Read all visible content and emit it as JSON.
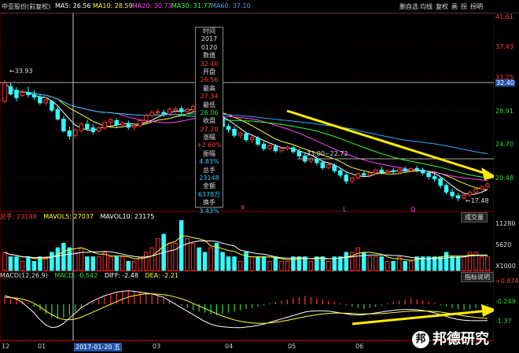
{
  "header": {
    "title": "中亚股份(前复权)",
    "ma5": "MA5: 26.56",
    "ma10": "MA10: 28.59",
    "ma20": "MA20: 30.73",
    "ma30": "MA30: 31.77",
    "ma60": "MA60: 37.10",
    "btn_self": "删自选",
    "btn_compare": "均线",
    "btn_chip": "复权",
    "btn_draw": "画",
    "btn_switch": "拐",
    "btn_last": "拐明"
  },
  "price_axis": {
    "labels": [
      "41.61",
      "37.43",
      "33.25",
      "32.40",
      "28.91",
      "24.70",
      "20.48",
      "17.48"
    ]
  },
  "annotations": {
    "high_mark": "←33.93",
    "mid_mark": "33.00~22.72",
    "low_mark": "←17.48",
    "mark_l": "L",
    "mark_q": "Q",
    "mark_r": "R"
  },
  "tooltip": {
    "rows": [
      {
        "text": "时间",
        "color": "#ddd"
      },
      {
        "text": "2017",
        "color": "#ddd"
      },
      {
        "text": "0120",
        "color": "#ddd"
      },
      {
        "text": "数值",
        "color": "#ddd"
      },
      {
        "text": "32.40",
        "color": "#ff4040"
      },
      {
        "text": "开盘",
        "color": "#ddd"
      },
      {
        "text": "26.56",
        "color": "#ff4040"
      },
      {
        "text": "最高",
        "color": "#ddd"
      },
      {
        "text": "27.34",
        "color": "#ff4040"
      },
      {
        "text": "最低",
        "color": "#ddd"
      },
      {
        "text": "26.06",
        "color": "#33dd33"
      },
      {
        "text": "收盘",
        "color": "#ddd"
      },
      {
        "text": "27.20",
        "color": "#ff4040"
      },
      {
        "text": "涨幅",
        "color": "#ddd"
      },
      {
        "text": "+2.60%",
        "color": "#ff4040"
      },
      {
        "text": "振幅",
        "color": "#ddd"
      },
      {
        "text": "4.83%",
        "color": "#33ccff"
      },
      {
        "text": "总手",
        "color": "#ddd"
      },
      {
        "text": "23148",
        "color": "#33ccff"
      },
      {
        "text": "金额",
        "color": "#ddd"
      },
      {
        "text": "6378万",
        "color": "#33ccff"
      },
      {
        "text": "换手",
        "color": "#ddd"
      },
      {
        "text": "3.43%",
        "color": "#33ccff"
      }
    ]
  },
  "volume_panel": {
    "label": "总手: 23148",
    "mavol5": "MAVOL5: 27037",
    "mavol10": "MAVOL10: 23175",
    "button": "成交量",
    "axis": [
      "11280",
      "5620",
      "X1000"
    ]
  },
  "macd_panel": {
    "label": "MACD(12,26,9)",
    "macd": "MACD: -0.542",
    "diff": "DIFF: -2.48",
    "dea": "DEA: -2.21",
    "button": "指标说明",
    "axis": [
      "+0.874",
      "-0.249",
      "-1.37"
    ]
  },
  "date_axis": {
    "labels": [
      "12",
      "01",
      "2017-01-20 五",
      "03",
      "04",
      "05",
      "06"
    ]
  },
  "watermark": {
    "logo": "邦",
    "text": "邦德研究"
  },
  "chart_data": {
    "type": "candlestick",
    "ylim": [
      16.5,
      42.5
    ],
    "candles": [
      [
        31.0,
        33.9,
        33.5,
        30.8
      ],
      [
        33.0,
        33.6,
        32.0,
        31.8
      ],
      [
        32.5,
        32.9,
        31.5,
        31.0
      ],
      [
        31.8,
        32.6,
        32.2,
        31.6
      ],
      [
        32.2,
        33.0,
        31.9,
        31.5
      ],
      [
        31.9,
        32.5,
        31.6,
        31.2
      ],
      [
        31.6,
        32.0,
        30.8,
        30.5
      ],
      [
        30.8,
        31.6,
        31.2,
        30.4
      ],
      [
        31.0,
        31.2,
        29.8,
        29.5
      ],
      [
        29.9,
        30.4,
        28.6,
        28.4
      ],
      [
        28.6,
        29.0,
        27.0,
        26.8
      ],
      [
        27.0,
        27.6,
        26.3,
        25.8
      ],
      [
        26.4,
        27.4,
        27.1,
        26.0
      ],
      [
        27.0,
        28.2,
        27.9,
        26.8
      ],
      [
        27.9,
        28.5,
        27.3,
        27.0
      ],
      [
        27.4,
        27.9,
        26.9,
        26.5
      ],
      [
        27.0,
        27.6,
        27.4,
        26.7
      ],
      [
        27.4,
        28.4,
        28.2,
        27.2
      ],
      [
        28.2,
        28.8,
        28.5,
        27.8
      ],
      [
        28.4,
        28.7,
        27.8,
        27.5
      ],
      [
        27.8,
        28.3,
        28.1,
        27.4
      ],
      [
        28.0,
        28.4,
        27.5,
        27.2
      ],
      [
        27.5,
        28.0,
        27.7,
        27.0
      ],
      [
        27.7,
        28.6,
        28.4,
        27.5
      ],
      [
        28.4,
        29.3,
        29.1,
        28.2
      ],
      [
        29.1,
        29.8,
        29.5,
        28.8
      ],
      [
        29.5,
        30.0,
        29.6,
        29.1
      ],
      [
        29.5,
        29.9,
        29.3,
        28.9
      ],
      [
        29.3,
        30.2,
        29.9,
        29.0
      ],
      [
        29.8,
        30.3,
        30.0,
        29.4
      ],
      [
        30.0,
        30.4,
        29.6,
        29.3
      ],
      [
        29.6,
        30.1,
        29.9,
        29.2
      ],
      [
        29.9,
        30.6,
        30.3,
        29.6
      ],
      [
        30.2,
        30.5,
        29.7,
        29.4
      ],
      [
        29.7,
        30.0,
        29.2,
        28.9
      ],
      [
        29.2,
        29.7,
        29.5,
        28.9
      ],
      [
        29.4,
        29.8,
        28.8,
        28.5
      ],
      [
        28.8,
        29.0,
        27.6,
        27.3
      ],
      [
        27.6,
        28.0,
        27.2,
        26.8
      ],
      [
        27.2,
        27.6,
        26.4,
        26.1
      ],
      [
        26.4,
        26.9,
        26.7,
        26.0
      ],
      [
        26.6,
        26.9,
        25.8,
        25.5
      ],
      [
        25.8,
        26.4,
        26.1,
        25.4
      ],
      [
        26.0,
        26.3,
        25.2,
        24.9
      ],
      [
        25.2,
        25.6,
        24.6,
        24.3
      ],
      [
        24.6,
        25.2,
        25.0,
        24.3
      ],
      [
        24.9,
        25.2,
        24.3,
        24.0
      ],
      [
        24.3,
        24.8,
        24.6,
        24.0
      ],
      [
        24.6,
        25.0,
        24.8,
        24.3
      ],
      [
        24.7,
        25.0,
        24.2,
        23.9
      ],
      [
        24.2,
        24.6,
        23.6,
        23.3
      ],
      [
        23.6,
        24.0,
        22.9,
        22.6
      ],
      [
        22.9,
        23.4,
        23.2,
        22.6
      ],
      [
        23.2,
        23.6,
        22.7,
        22.3
      ],
      [
        22.7,
        23.0,
        22.0,
        21.7
      ],
      [
        22.0,
        22.6,
        22.4,
        21.8
      ],
      [
        22.3,
        22.6,
        21.6,
        21.3
      ],
      [
        21.6,
        22.0,
        21.0,
        20.6
      ],
      [
        21.0,
        21.4,
        20.2,
        19.8
      ],
      [
        20.2,
        20.8,
        20.6,
        19.9
      ],
      [
        20.6,
        21.4,
        21.2,
        20.4
      ],
      [
        21.2,
        21.6,
        21.0,
        20.7
      ],
      [
        21.0,
        21.5,
        21.3,
        20.8
      ],
      [
        21.3,
        21.9,
        21.7,
        21.1
      ],
      [
        21.7,
        22.2,
        21.4,
        21.1
      ],
      [
        21.4,
        21.8,
        21.6,
        21.1
      ],
      [
        21.6,
        22.0,
        21.5,
        21.2
      ],
      [
        21.5,
        21.9,
        21.8,
        21.2
      ],
      [
        21.8,
        22.2,
        21.6,
        21.3
      ],
      [
        21.6,
        22.0,
        21.9,
        21.4
      ],
      [
        21.9,
        22.3,
        21.7,
        21.4
      ],
      [
        21.7,
        22.0,
        21.3,
        21.0
      ],
      [
        21.3,
        21.6,
        20.8,
        20.4
      ],
      [
        20.8,
        21.2,
        20.5,
        20.1
      ],
      [
        20.5,
        20.8,
        19.6,
        19.2
      ],
      [
        19.6,
        19.9,
        18.7,
        18.4
      ],
      [
        18.7,
        19.2,
        18.2,
        17.8
      ],
      [
        18.2,
        18.6,
        17.9,
        17.48
      ],
      [
        17.9,
        18.5,
        18.3,
        17.7
      ],
      [
        18.3,
        18.9,
        18.7,
        18.1
      ],
      [
        18.7,
        19.3,
        19.1,
        18.5
      ],
      [
        19.1,
        19.6,
        19.4,
        18.9
      ],
      [
        19.4,
        20.0,
        19.8,
        19.2
      ]
    ],
    "volume": [
      4,
      3,
      3,
      2,
      3,
      2,
      3,
      3,
      4,
      5,
      6,
      5,
      4,
      5,
      3,
      3,
      3,
      4,
      3,
      3,
      3,
      2,
      2,
      3,
      4,
      5,
      7,
      8,
      6,
      6,
      11,
      7,
      6,
      5,
      4,
      5,
      6,
      4,
      3,
      3,
      2,
      4,
      3,
      3,
      3,
      2,
      3,
      2,
      2,
      3,
      3,
      3,
      2,
      3,
      3,
      2,
      3,
      3,
      4,
      4,
      5,
      4,
      3,
      3,
      3,
      2,
      2,
      3,
      2,
      2,
      3,
      3,
      3,
      3,
      3,
      4,
      3,
      3,
      3,
      4,
      4,
      3,
      3
    ],
    "macd_hist": [
      0.3,
      0.25,
      0.2,
      0.15,
      0.05,
      -0.1,
      -0.25,
      -0.4,
      -0.55,
      -0.6,
      -0.55,
      -0.45,
      -0.3,
      -0.15,
      -0.05,
      0.1,
      0.2,
      0.3,
      0.4,
      0.45,
      0.55,
      0.6,
      0.55,
      0.5,
      0.45,
      0.4,
      0.35,
      0.25,
      0.15,
      0.05,
      -0.05,
      -0.15,
      -0.25,
      -0.3,
      -0.35,
      -0.4,
      -0.45,
      -0.4,
      -0.35,
      -0.3,
      -0.25,
      -0.2,
      -0.15,
      -0.1,
      -0.05,
      0.05,
      0.1,
      0.15,
      0.2,
      0.25,
      0.3,
      0.35,
      0.3,
      0.25,
      0.2,
      0.15,
      0.1,
      0.05,
      -0.05,
      -0.1,
      -0.15,
      -0.2,
      -0.15,
      -0.1,
      -0.05,
      0.05,
      0.1,
      0.15,
      0.2,
      0.25,
      0.2,
      0.15,
      0.1,
      0.05,
      -0.05,
      -0.1,
      -0.15,
      -0.2,
      -0.25,
      -0.2,
      -0.15,
      -0.1,
      -0.05
    ],
    "macd_diff": [
      0.5,
      0.4,
      0.3,
      0.1,
      -0.2,
      -0.5,
      -0.9,
      -1.2,
      -1.35,
      -1.3,
      -1.1,
      -0.8,
      -0.5,
      -0.2,
      0.0,
      0.2,
      0.35,
      0.5,
      0.6,
      0.7,
      0.75,
      0.78,
      0.75,
      0.7,
      0.65,
      0.6,
      0.5,
      0.4,
      0.2,
      0.0,
      -0.2,
      -0.4,
      -0.6,
      -0.8,
      -1.0,
      -1.15,
      -1.25,
      -1.3,
      -1.33,
      -1.35,
      -1.35,
      -1.32,
      -1.28,
      -1.22,
      -1.15,
      -1.05,
      -0.95,
      -0.85,
      -0.75,
      -0.65,
      -0.55,
      -0.45,
      -0.4,
      -0.38,
      -0.38,
      -0.4,
      -0.45,
      -0.5,
      -0.55,
      -0.6,
      -0.62,
      -0.6,
      -0.55,
      -0.5,
      -0.45,
      -0.4,
      -0.35,
      -0.32,
      -0.3,
      -0.3,
      -0.32,
      -0.36,
      -0.42,
      -0.5,
      -0.6,
      -0.7,
      -0.8,
      -0.88,
      -0.92,
      -0.94,
      -0.95,
      -0.95,
      -0.94
    ],
    "macd_dea": [
      0.4,
      0.4,
      0.35,
      0.3,
      0.2,
      0.05,
      -0.15,
      -0.4,
      -0.6,
      -0.78,
      -0.88,
      -0.9,
      -0.85,
      -0.75,
      -0.6,
      -0.45,
      -0.3,
      -0.15,
      0.0,
      0.15,
      0.3,
      0.42,
      0.5,
      0.56,
      0.6,
      0.6,
      0.58,
      0.55,
      0.5,
      0.42,
      0.32,
      0.2,
      0.05,
      -0.1,
      -0.25,
      -0.4,
      -0.55,
      -0.68,
      -0.8,
      -0.9,
      -0.98,
      -1.04,
      -1.08,
      -1.1,
      -1.1,
      -1.08,
      -1.04,
      -0.99,
      -0.93,
      -0.86,
      -0.79,
      -0.72,
      -0.66,
      -0.6,
      -0.56,
      -0.53,
      -0.51,
      -0.51,
      -0.52,
      -0.53,
      -0.55,
      -0.56,
      -0.56,
      -0.55,
      -0.53,
      -0.51,
      -0.48,
      -0.45,
      -0.42,
      -0.4,
      -0.39,
      -0.39,
      -0.4,
      -0.42,
      -0.45,
      -0.5,
      -0.55,
      -0.61,
      -0.67,
      -0.72,
      -0.76,
      -0.79,
      -0.82
    ]
  }
}
